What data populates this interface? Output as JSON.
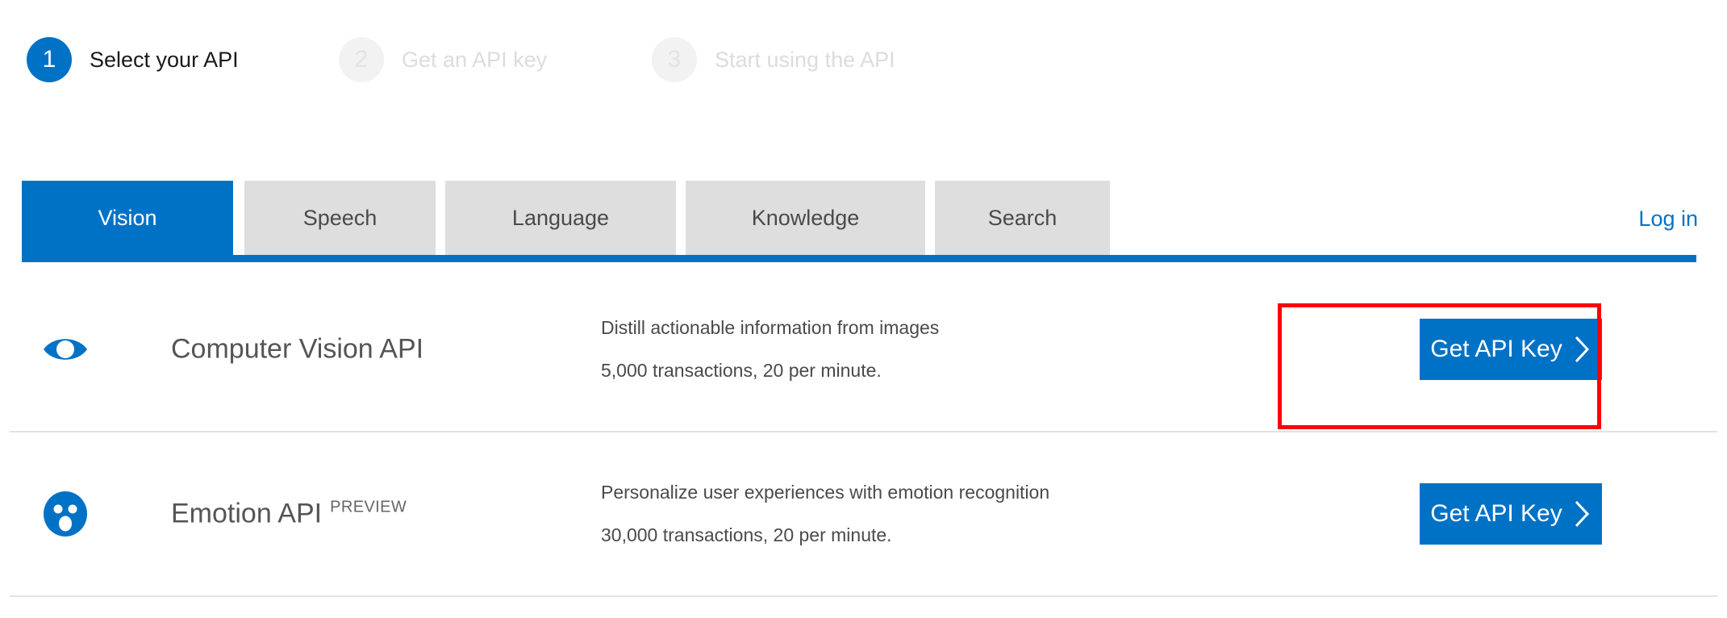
{
  "colors": {
    "brand_blue": "#0072c6",
    "tab_inactive_bg": "#dedede",
    "step_inactive_bg": "#f2f2f2",
    "highlight_red": "#ff0000",
    "divider": "#e3e3e3"
  },
  "steps": [
    {
      "number": "1",
      "label": "Select your API",
      "state": "active"
    },
    {
      "number": "2",
      "label": "Get an API key",
      "state": "inactive"
    },
    {
      "number": "3",
      "label": "Start using the API",
      "state": "inactive"
    }
  ],
  "tabs": [
    {
      "label": "Vision",
      "selected": true
    },
    {
      "label": "Speech",
      "selected": false
    },
    {
      "label": "Language",
      "selected": false
    },
    {
      "label": "Knowledge",
      "selected": false
    },
    {
      "label": "Search",
      "selected": false
    }
  ],
  "account": {
    "login_label": "Log in"
  },
  "api_list": [
    {
      "icon": "eye-icon",
      "title": "Computer Vision API",
      "badge": "",
      "description": "Distill actionable information from images",
      "quota": "5,000 transactions, 20 per minute.",
      "button_label": "Get API Key",
      "highlighted": true
    },
    {
      "icon": "surprised-face-icon",
      "title": "Emotion API",
      "badge": "PREVIEW",
      "description": "Personalize user experiences with emotion recognition",
      "quota": "30,000 transactions, 20 per minute.",
      "button_label": "Get API Key",
      "highlighted": false
    }
  ]
}
